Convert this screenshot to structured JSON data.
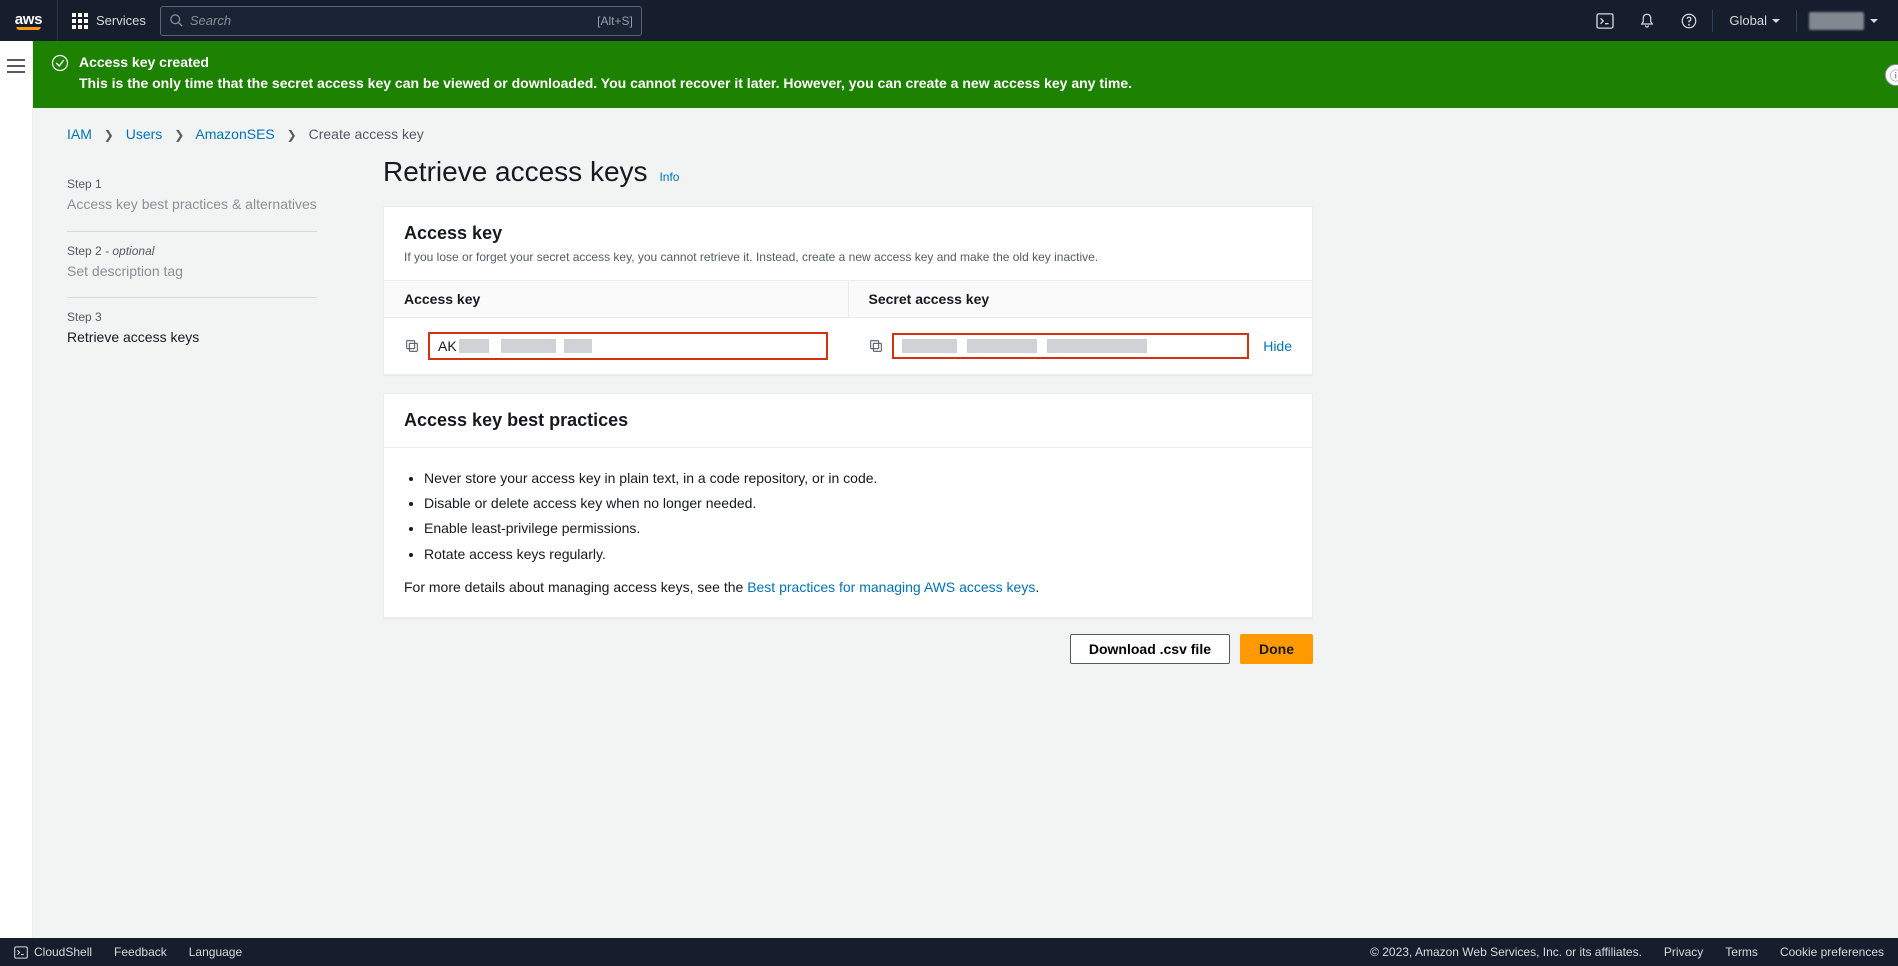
{
  "topnav": {
    "services_label": "Services",
    "search_placeholder": "Search",
    "search_shortcut": "[Alt+S]",
    "region": "Global"
  },
  "flash": {
    "title": "Access key created",
    "body": "This is the only time that the secret access key can be viewed or downloaded. You cannot recover it later. However, you can create a new access key any time."
  },
  "breadcrumbs": {
    "iam": "IAM",
    "users": "Users",
    "user": "AmazonSES",
    "current": "Create access key"
  },
  "wizard": {
    "step1_lbl": "Step 1",
    "step1_title": "Access key best practices & alternatives",
    "step2_lbl": "Step 2",
    "step2_optional": " - optional",
    "step2_title": "Set description tag",
    "step3_lbl": "Step 3",
    "step3_title": "Retrieve access keys"
  },
  "heading": "Retrieve access keys",
  "info": "Info",
  "keypanel": {
    "title": "Access key",
    "sub": "If you lose or forget your secret access key, you cannot retrieve it. Instead, create a new access key and make the old key inactive.",
    "col_access": "Access key",
    "col_secret": "Secret access key",
    "access_prefix": "AK",
    "hide": "Hide"
  },
  "bp": {
    "title": "Access key best practices",
    "items": [
      "Never store your access key in plain text, in a code repository, or in code.",
      "Disable or delete access key when no longer needed.",
      "Enable least-privilege permissions.",
      "Rotate access keys regularly."
    ],
    "more_prefix": "For more details about managing access keys, see the ",
    "more_link": "Best practices for managing AWS access keys",
    "more_suffix": "."
  },
  "actions": {
    "download": "Download .csv file",
    "done": "Done"
  },
  "footer": {
    "cloudshell": "CloudShell",
    "feedback": "Feedback",
    "language": "Language",
    "copyright": "© 2023, Amazon Web Services, Inc. or its affiliates.",
    "privacy": "Privacy",
    "terms": "Terms",
    "cookies": "Cookie preferences"
  }
}
